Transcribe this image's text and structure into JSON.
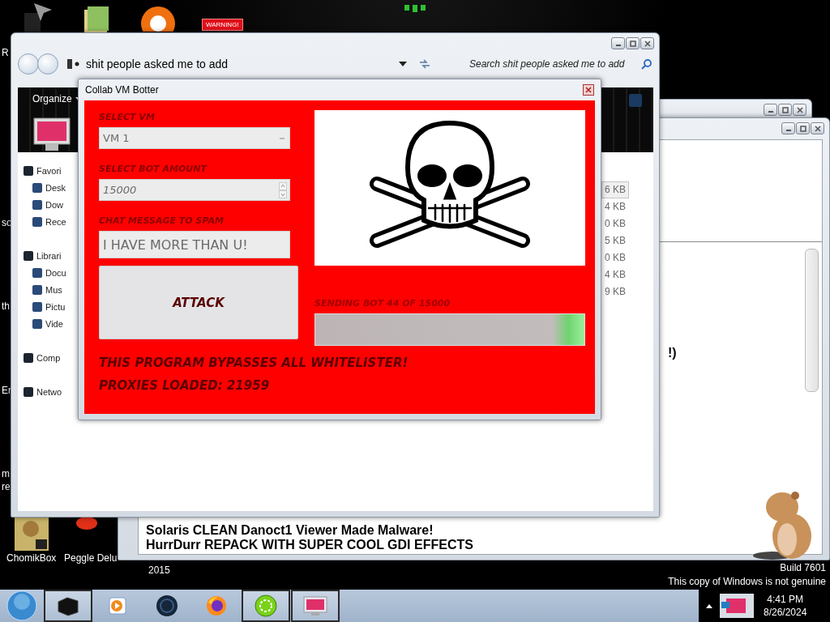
{
  "desktop": {
    "edge_labels": [
      "R",
      "so",
      "th",
      "Er",
      "m",
      "re"
    ],
    "warning_badge": "WARNING!",
    "icons": [
      {
        "label": "ChomikBox"
      },
      {
        "label": "Peggle Delu"
      }
    ],
    "caption": "2015",
    "notice": [
      "Build 7601",
      "This copy of Windows is not genuine"
    ]
  },
  "editor": {
    "lines": [
      {
        "text": "!)",
        "kind": "cut"
      },
      {
        "text": "Solaris CLEAN Danoct1 Viewer Made Malware!",
        "kind": "full"
      },
      {
        "text": "HurrDurr REPACK WITH SUPER COOL GDI EFFECTS",
        "kind": "full"
      }
    ]
  },
  "explorer": {
    "address": "shit people asked me to add",
    "search": {
      "placeholder": "Search shit people asked me to add"
    },
    "organize": "Organize",
    "nav": [
      {
        "label": "Favori",
        "children": [
          {
            "label": "Desk"
          },
          {
            "label": "Dow"
          },
          {
            "label": "Rece"
          }
        ]
      },
      {
        "label": "Librari",
        "children": [
          {
            "label": "Docu"
          },
          {
            "label": "Mus"
          },
          {
            "label": "Pictu"
          },
          {
            "label": "Vide"
          }
        ]
      },
      {
        "label": "Comp"
      },
      {
        "label": "Netwo"
      }
    ],
    "sizes": [
      {
        "text": "6 KB",
        "selected": true
      },
      {
        "text": "4 KB",
        "selected": false
      },
      {
        "text": "0 KB",
        "selected": false
      },
      {
        "text": "5 KB",
        "selected": false
      },
      {
        "text": "0 KB",
        "selected": false
      },
      {
        "text": "4 KB",
        "selected": false
      },
      {
        "text": "9 KB",
        "selected": false
      }
    ]
  },
  "botter": {
    "title": "Collab VM Botter",
    "vm_label": "SELECT VM",
    "vm_value": "VM 1",
    "amount_label": "SELECT BOT AMOUNT",
    "amount_value": "15000",
    "message_label": "CHAT MESSAGE TO SPAM",
    "message_value": "I HAVE MORE THAN U!",
    "attack": "ATTACK",
    "status": "SENDING BOT 44 OF 15000",
    "progress": {
      "level": 1
    },
    "notes": [
      "THIS PROGRAM BYPASSES ALL WHITELISTER!",
      "PROXIES LOADED: 21959"
    ]
  },
  "taskbar": {
    "apps": [
      {
        "kind": "box",
        "running": true
      },
      {
        "kind": "player",
        "running": false
      },
      {
        "kind": "globe",
        "running": false
      },
      {
        "kind": "firefox",
        "running": false
      },
      {
        "kind": "wheel",
        "running": true
      },
      {
        "kind": "monitor",
        "running": true
      }
    ],
    "clock": {
      "time": "4:41 PM",
      "date": "8/26/2024"
    }
  }
}
